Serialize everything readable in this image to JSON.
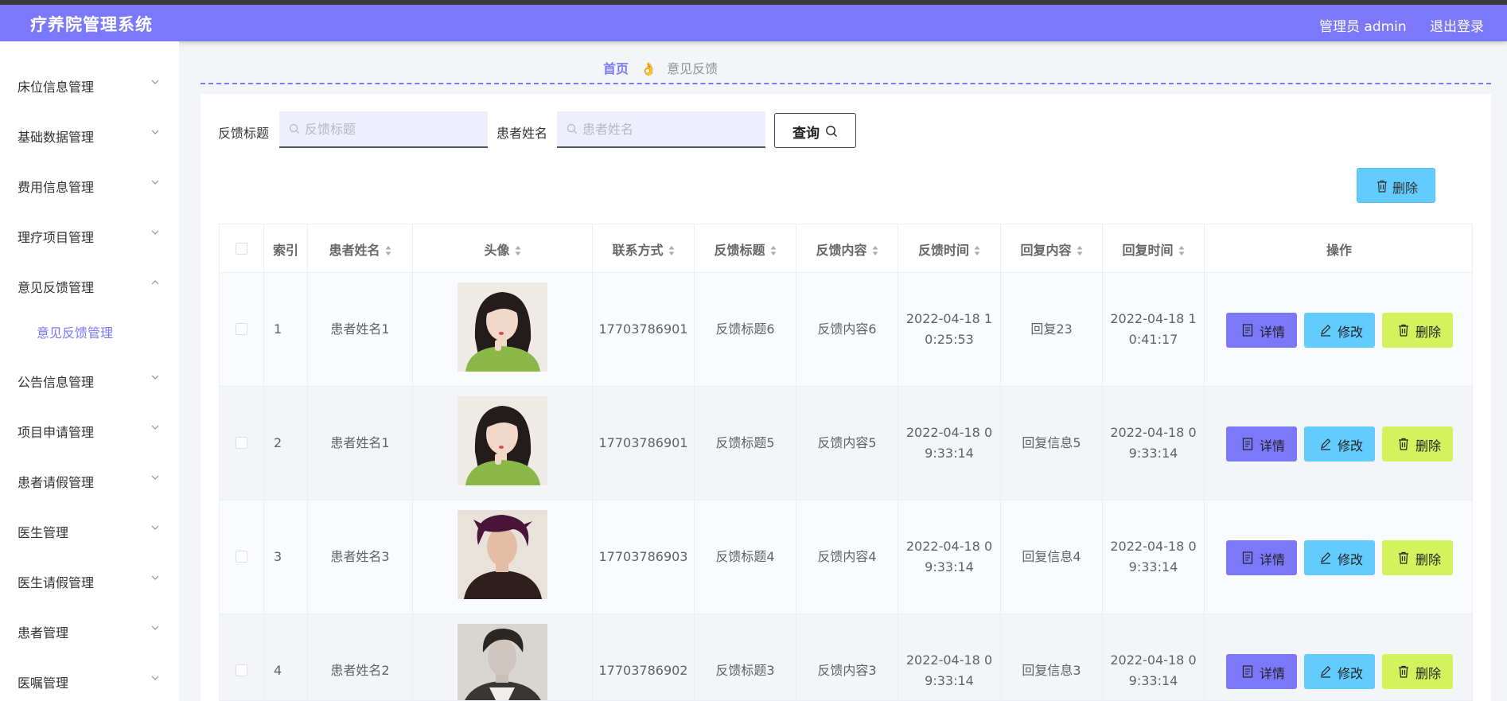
{
  "header": {
    "title": "疗养院管理系统",
    "user": "管理员 admin",
    "logout": "退出登录"
  },
  "sidebar": {
    "items": [
      {
        "label": "床位信息管理"
      },
      {
        "label": "基础数据管理"
      },
      {
        "label": "费用信息管理"
      },
      {
        "label": "理疗项目管理"
      },
      {
        "label": "意见反馈管理"
      },
      {
        "label": "公告信息管理"
      },
      {
        "label": "项目申请管理"
      },
      {
        "label": "患者请假管理"
      },
      {
        "label": "医生管理"
      },
      {
        "label": "医生请假管理"
      },
      {
        "label": "患者管理"
      },
      {
        "label": "医嘱管理"
      }
    ],
    "submenu": {
      "label": "意见反馈管理"
    }
  },
  "breadcrumb": {
    "home": "首页",
    "separator": "👌",
    "current": "意见反馈"
  },
  "search": {
    "title_label": "反馈标题",
    "title_placeholder": "反馈标题",
    "name_label": "患者姓名",
    "name_placeholder": "患者姓名",
    "query_label": "查询"
  },
  "toolbar": {
    "delete_label": "删除"
  },
  "table": {
    "columns": [
      "索引",
      "患者姓名",
      "头像",
      "联系方式",
      "反馈标题",
      "反馈内容",
      "反馈时间",
      "回复内容",
      "回复时间",
      "操作"
    ],
    "rows": [
      {
        "index": "1",
        "name": "患者姓名1",
        "phone": "17703786901",
        "title": "反馈标题6",
        "content": "反馈内容6",
        "time1": "2022-04-18 1",
        "time2": "0:25:53",
        "reply": "回复23",
        "rtime1": "2022-04-18 1",
        "rtime2": "0:41:17"
      },
      {
        "index": "2",
        "name": "患者姓名1",
        "phone": "17703786901",
        "title": "反馈标题5",
        "content": "反馈内容5",
        "time1": "2022-04-18 0",
        "time2": "9:33:14",
        "reply": "回复信息5",
        "rtime1": "2022-04-18 0",
        "rtime2": "9:33:14"
      },
      {
        "index": "3",
        "name": "患者姓名3",
        "phone": "17703786903",
        "title": "反馈标题4",
        "content": "反馈内容4",
        "time1": "2022-04-18 0",
        "time2": "9:33:14",
        "reply": "回复信息4",
        "rtime1": "2022-04-18 0",
        "rtime2": "9:33:14"
      },
      {
        "index": "4",
        "name": "患者姓名2",
        "phone": "17703786902",
        "title": "反馈标题3",
        "content": "反馈内容3",
        "time1": "2022-04-18 0",
        "time2": "9:33:14",
        "reply": "回复信息3",
        "rtime1": "2022-04-18 0",
        "rtime2": "9:33:14"
      }
    ],
    "actions": {
      "detail": "详情",
      "edit": "修改",
      "delete": "删除"
    }
  },
  "colors": {
    "primary": "#7b78f9",
    "info": "#62ccff",
    "danger": "#d3f25c"
  }
}
